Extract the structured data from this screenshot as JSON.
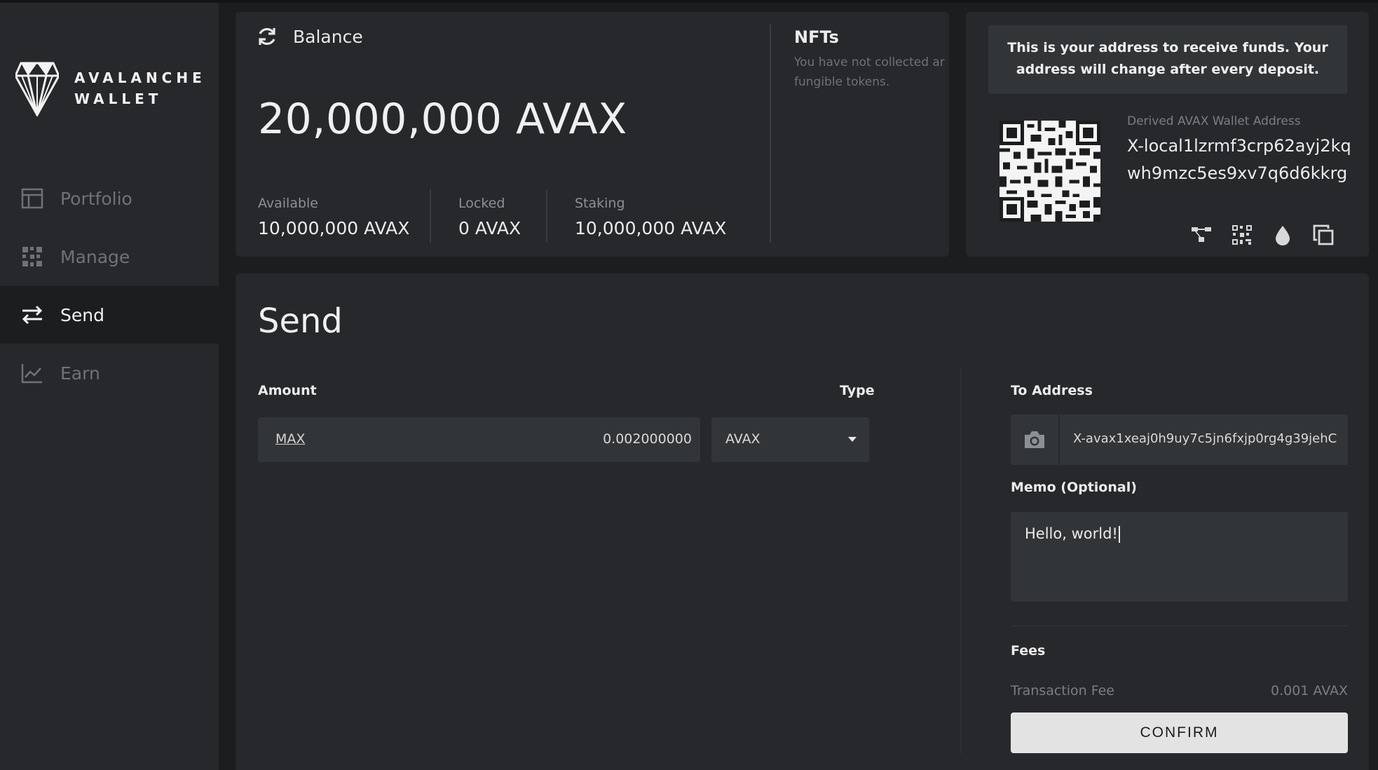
{
  "app": {
    "logo_line1": "AVALANCHE",
    "logo_line2": "WALLET"
  },
  "sidebar": {
    "items": [
      {
        "label": "Portfolio",
        "icon": "portfolio-icon",
        "active": false
      },
      {
        "label": "Manage",
        "icon": "manage-icon",
        "active": false
      },
      {
        "label": "Send",
        "icon": "send-icon",
        "active": true
      },
      {
        "label": "Earn",
        "icon": "earn-icon",
        "active": false
      }
    ]
  },
  "balance": {
    "title": "Balance",
    "total": "20,000,000 AVAX",
    "available_label": "Available",
    "available_value": "10,000,000 AVAX",
    "locked_label": "Locked",
    "locked_value": "0 AVAX",
    "staking_label": "Staking",
    "staking_value": "10,000,000 AVAX"
  },
  "nfts": {
    "title": "NFTs",
    "desc_line1": "You have not collected ar",
    "desc_line2": "fungible tokens."
  },
  "address": {
    "note": "This is your address to receive funds. Your address will change after every deposit.",
    "label": "Derived AVAX Wallet Address",
    "value": "X-local1lzrmf3crp62ayj2kqwh9mzc5es9xv7q6d6kkrg",
    "actions": [
      "derived-addresses-icon",
      "qr-code-icon",
      "faucet-drop-icon",
      "copy-icon"
    ]
  },
  "send": {
    "title": "Send",
    "amount_label": "Amount",
    "type_label": "Type",
    "max_label": "MAX",
    "amount_value": "0.002000000",
    "type_value": "AVAX",
    "to_label": "To Address",
    "to_value": "X-avax1xeaj0h9uy7c5jn6fxjp0rg4g39jehC",
    "memo_label": "Memo (Optional)",
    "memo_value": "Hello, world!",
    "fees_label": "Fees",
    "fee_name": "Transaction Fee",
    "fee_value": "0.001 AVAX",
    "confirm_label": "CONFIRM"
  },
  "colors": {
    "background": "#1b1d1f",
    "card": "#26282b",
    "input": "#323538",
    "button": "#e3e3e3"
  }
}
